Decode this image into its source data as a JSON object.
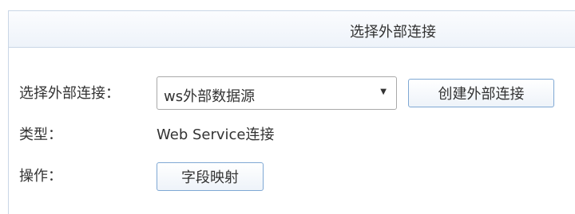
{
  "panel": {
    "title": "选择外部连接"
  },
  "form": {
    "connection_label": "选择外部连接：",
    "connection_selected": "ws外部数据源",
    "create_button_label": "创建外部连接",
    "type_label": "类型：",
    "type_value": "Web Service连接",
    "operation_label": "操作：",
    "field_mapping_button_label": "字段映射"
  },
  "icons": {
    "dropdown_arrow": "▼"
  },
  "colors": {
    "header_background": "#eef3fa",
    "border": "#c9d6e6",
    "button_border": "#7fa8d4",
    "text": "#333333"
  }
}
